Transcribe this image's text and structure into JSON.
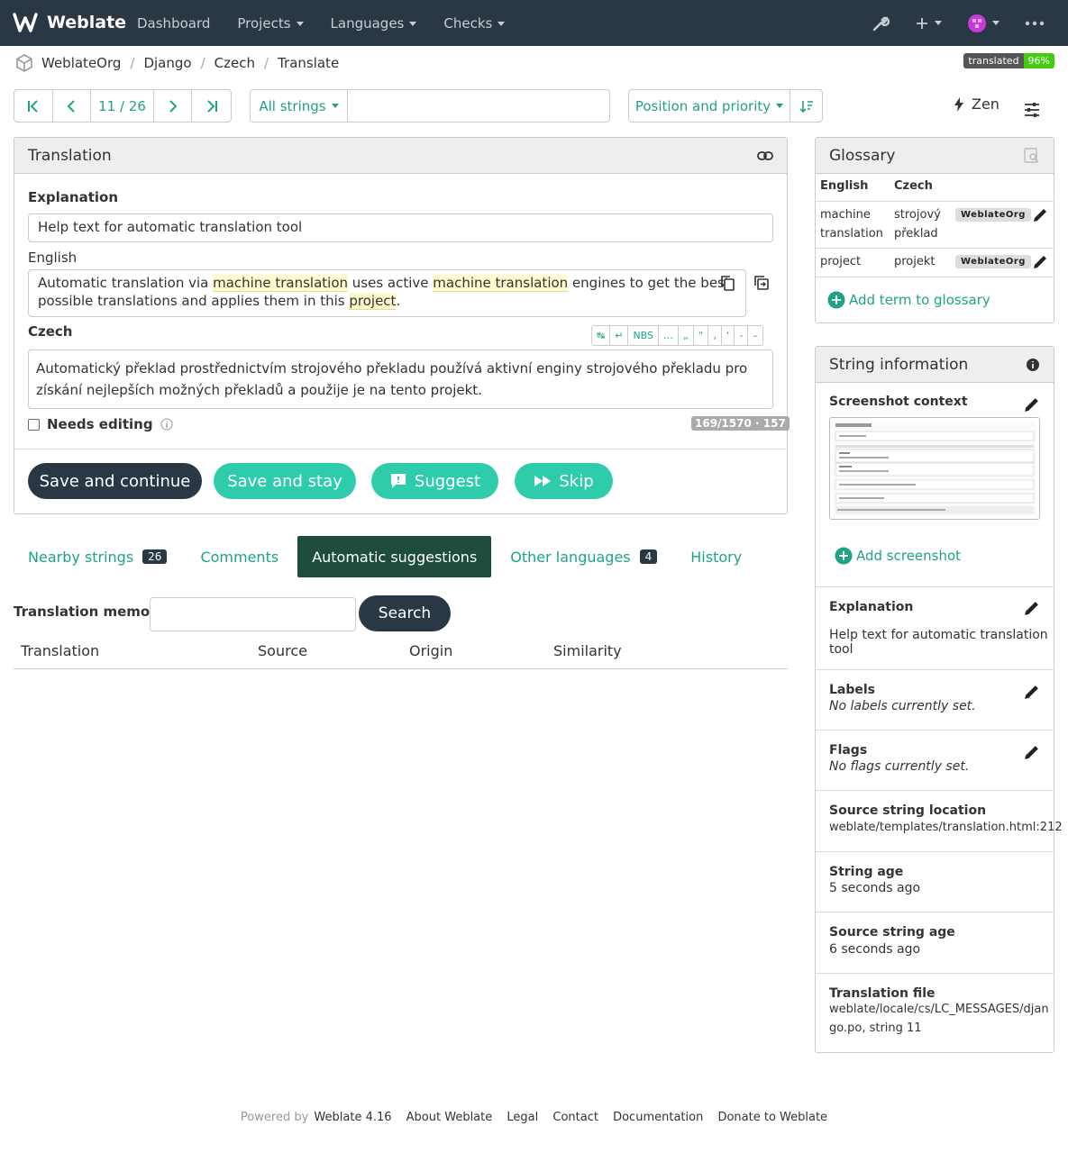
{
  "nav": {
    "brand": "Weblate",
    "menu": [
      "Dashboard",
      "Projects",
      "Languages",
      "Checks"
    ]
  },
  "breadcrumb": [
    "WeblateOrg",
    "Django",
    "Czech",
    "Translate"
  ],
  "status_badge": {
    "label": "translated",
    "value": "96%"
  },
  "pager": {
    "position": "11 / 26"
  },
  "filter": {
    "label": "All strings",
    "query": ""
  },
  "sort": {
    "label": "Position and priority"
  },
  "zen_label": "Zen",
  "translation_panel": {
    "title": "Translation",
    "explanation_label": "Explanation",
    "explanation_value": "Help text for automatic translation tool",
    "source_lang": "English",
    "source_parts": [
      "Automatic translation via ",
      "machine translation",
      " uses active ",
      "machine translation",
      " engines to get the best possible translations and applies them in this ",
      "project",
      "."
    ],
    "target_lang": "Czech",
    "target_text": "Automatický překlad prostřednictvím strojového překladu používá aktivní enginy strojového překladu pro získání nejlepších možných překladů a použije je na tento projekt.",
    "special_chars": [
      "↹",
      "↵",
      "NBS",
      "…",
      "„",
      "“",
      "‚",
      "‘",
      "-",
      "–"
    ],
    "needs_editing": "Needs editing",
    "counter": "169/1570 · 157",
    "buttons": {
      "save_continue": "Save and continue",
      "save_stay": "Save and stay",
      "suggest": "Suggest",
      "skip": "Skip"
    }
  },
  "tabs": [
    {
      "label": "Nearby strings",
      "count": "26"
    },
    {
      "label": "Comments",
      "count": ""
    },
    {
      "label": "Automatic suggestions",
      "count": ""
    },
    {
      "label": "Other languages",
      "count": "4"
    },
    {
      "label": "History",
      "count": ""
    }
  ],
  "tm": {
    "label": "Translation memory",
    "search_value": "",
    "search_button": "Search",
    "columns": [
      "Translation",
      "Source",
      "Origin",
      "Similarity"
    ]
  },
  "glossary": {
    "title": "Glossary",
    "col_source": "English",
    "col_target": "Czech",
    "rows": [
      {
        "source": "machine translation",
        "target": "strojový překlad",
        "project": "WeblateOrg"
      },
      {
        "source": "project",
        "target": "projekt",
        "project": "WeblateOrg"
      }
    ],
    "add_label": "Add term to glossary"
  },
  "string_info": {
    "title": "String information",
    "screenshot_context": "Screenshot context",
    "add_screenshot": "Add screenshot",
    "explanation_label": "Explanation",
    "explanation_value": "Help text for automatic translation tool",
    "labels_label": "Labels",
    "labels_value": "No labels currently set.",
    "flags_label": "Flags",
    "flags_value": "No flags currently set.",
    "location_label": "Source string location",
    "location_value": "weblate/templates/translation.html:212",
    "age_label": "String age",
    "age_value": "5 seconds ago",
    "source_age_label": "Source string age",
    "source_age_value": "6 seconds ago",
    "file_label": "Translation file",
    "file_value_1": "weblate/locale/cs/LC_MESSAGES/djan",
    "file_value_2": "go.po, string 11"
  },
  "footer": {
    "powered": "Powered by",
    "version": "Weblate 4.16",
    "links": [
      "About Weblate",
      "Legal",
      "Contact",
      "Documentation",
      "Donate to Weblate"
    ]
  },
  "colors": {
    "navbar": "#2a3744",
    "accent": "#1fa385",
    "primary_button": "#2a3744",
    "secondary_button": "#2eccaa",
    "active_tab": "#1e4d3d"
  }
}
